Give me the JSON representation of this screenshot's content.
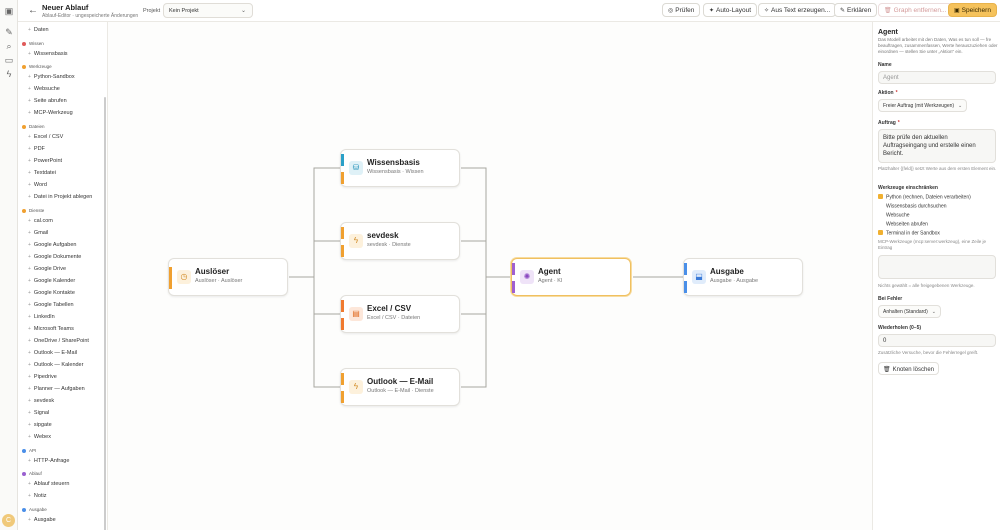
{
  "app": {
    "title": "Neuer Ablauf",
    "subtitle": "Ablauf-Editor · ungespeicherte Änderungen",
    "avatar_initial": "C"
  },
  "toolbar": {
    "project_label": "Projekt",
    "project_value": "Kein Projekt",
    "check_label": "Prüfen",
    "autolayout_label": "Auto-Layout",
    "fromtext_label": "Aus Text erzeugen...",
    "explain_label": "Erklären",
    "clear_label": "Graph entfernen...",
    "save_label": "Speichern"
  },
  "library": {
    "top_item": "Daten",
    "groups": [
      {
        "label": "Wissen",
        "items": [
          "Wissensbasis"
        ]
      },
      {
        "label": "Werkzeuge",
        "items": [
          "Python-Sandbox",
          "Websuche",
          "Seite abrufen",
          "MCP-Werkzeug"
        ]
      },
      {
        "label": "Dateien",
        "items": [
          "Excel / CSV",
          "PDF",
          "PowerPoint",
          "Textdatei",
          "Word",
          "Datei in Projekt ablegen"
        ]
      },
      {
        "label": "Dienste",
        "items": [
          "cal.com",
          "Gmail",
          "Google Aufgaben",
          "Google Dokumente",
          "Google Drive",
          "Google Kalender",
          "Google Kontakte",
          "Google Tabellen",
          "LinkedIn",
          "Microsoft Teams",
          "OneDrive / SharePoint",
          "Outlook — E-Mail",
          "Outlook — Kalender",
          "Pipedrive",
          "Planner — Aufgaben",
          "sevdesk",
          "Signal",
          "sipgate",
          "Webex"
        ]
      },
      {
        "label": "API",
        "items": [
          "HTTP-Anfrage"
        ]
      },
      {
        "label": "Ablauf",
        "items": [
          "Ablauf steuern",
          "Notiz"
        ]
      },
      {
        "label": "Ausgabe",
        "items": [
          "Ausgabe"
        ]
      }
    ]
  },
  "nodes": [
    {
      "id": "ausloeser",
      "title": "Auslöser",
      "sub": "Auslöser · Auslöser",
      "color": "#f0a030",
      "icon": "clock-icon"
    },
    {
      "id": "wissensbasis",
      "title": "Wissensbasis",
      "sub": "Wissensbasis · Wissen",
      "color": "#2aa0c8",
      "icon": "database-icon"
    },
    {
      "id": "sevdesk",
      "title": "sevdesk",
      "sub": "sevdesk · Dienste",
      "color": "#f0a030",
      "icon": "bolt-icon"
    },
    {
      "id": "excel",
      "title": "Excel / CSV",
      "sub": "Excel / CSV · Dateien",
      "color": "#f07a30",
      "icon": "file-icon"
    },
    {
      "id": "outlook",
      "title": "Outlook — E-Mail",
      "sub": "Outlook — E-Mail · Dienste",
      "color": "#f0a030",
      "icon": "bolt-icon"
    },
    {
      "id": "agent",
      "title": "Agent",
      "sub": "Agent · KI",
      "color": "#a060d0",
      "icon": "agent-icon"
    },
    {
      "id": "ausgabe",
      "title": "Ausgabe",
      "sub": "Ausgabe · Ausgabe",
      "color": "#4a8fe8",
      "icon": "output-icon"
    }
  ],
  "panel": {
    "heading": "Agent",
    "description": "Das Modell arbeitet mit den Daten, Was es tun soll — fre beauftragen, zusammenfassen, Werte herauszuziehen oder einordnen — stellen Sie unter „Aktion\" ein.",
    "name_label": "Name",
    "name_placeholder": "Agent",
    "action_label": "Aktion",
    "action_value": "Freier Auftrag (mit Werkzeugen)",
    "task_label": "Auftrag",
    "task_value": "Bitte prüfe den aktuellen Auftragseingang und erstelle einen Bericht.",
    "task_hint": "Platzhalter {{feld}} setzt Werte aus dem ersten Element ein.",
    "tools_label": "Werkzeuge einschränken",
    "tools": [
      {
        "label": "Python (rechnen, Dateien verarbeiten)",
        "checked": true
      },
      {
        "label": "Wissensbasis durchsuchen",
        "checked": false
      },
      {
        "label": "Websuche",
        "checked": false
      },
      {
        "label": "Webseiten abrufen",
        "checked": false
      },
      {
        "label": "Terminal in der Sandbox",
        "checked": true
      }
    ],
    "mcp_hint": "MCP-Werkzeuge (mcp:server:werkzeug), eine Zeile je Eintrag",
    "mcp_foot": "Nichts gewählt = alle freigegebenen Werkzeuge.",
    "error_label": "Bei Fehler",
    "error_value": "Anhalten (Standard)",
    "retry_label": "Wiederholen (0–5)",
    "retry_value": "0",
    "retry_hint": "Zusätzliche Versuche, bevor die Fehlerregel greift.",
    "delete_label": "Knoten löschen"
  }
}
